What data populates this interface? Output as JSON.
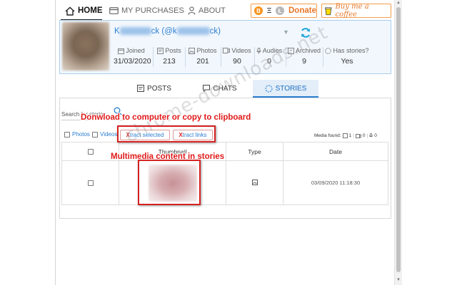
{
  "nav": {
    "home": "HOME",
    "purchases": "MY PURCHASES",
    "about": "ABOUT"
  },
  "donate": {
    "label": "Donate",
    "coins": [
      "B",
      "Ξ",
      "Ł"
    ]
  },
  "coffee": {
    "label": "Buy me a coffee"
  },
  "profile": {
    "name_prefix": "K",
    "name_mid": "ck (@k",
    "name_suffix": "ck)",
    "stats": [
      {
        "label": "Joined",
        "value": "31/03/2020",
        "icon": "calendar-icon"
      },
      {
        "label": "Posts",
        "value": "213",
        "icon": "posts-icon"
      },
      {
        "label": "Photos",
        "value": "201",
        "icon": "photo-icon"
      },
      {
        "label": "Videos",
        "value": "90",
        "icon": "video-icon"
      },
      {
        "label": "Audios",
        "value": "0",
        "icon": "microphone-icon"
      },
      {
        "label": "Archived",
        "value": "9",
        "icon": "archive-icon"
      },
      {
        "label": "Has stories?",
        "value": "Yes",
        "icon": "stories-icon"
      }
    ]
  },
  "tabs": {
    "posts": "POSTS",
    "chats": "CHATS",
    "stories": "STORIES"
  },
  "search": {
    "label": "Search for stories"
  },
  "filters": {
    "photos": "Photos",
    "videos": "Videos"
  },
  "actions": {
    "xtract_selected_x": "X",
    "xtract_selected_rest": "tract selected",
    "xtract_links_x": "X",
    "xtract_links_rest": "tract links"
  },
  "media_found": {
    "label": "Media found:",
    "photos": "1",
    "videos": "0",
    "audios": "0"
  },
  "table": {
    "headers": {
      "thumbnail": "Thumbnail",
      "type": "Type",
      "date": "Date"
    },
    "rows": [
      {
        "date": "03/09/2020 11:18:30",
        "type_icon": "image-icon"
      }
    ]
  },
  "annotations": {
    "download": "Donwload to computer or copy to clipboard",
    "multimedia": "Multimedia content in stories"
  },
  "watermark": "chrome-downloads.net",
  "colors": {
    "accent": "#2b7ed0",
    "donate": "#e8772a",
    "annotation": "#d42020",
    "card_bg": "#f1f7fd"
  }
}
